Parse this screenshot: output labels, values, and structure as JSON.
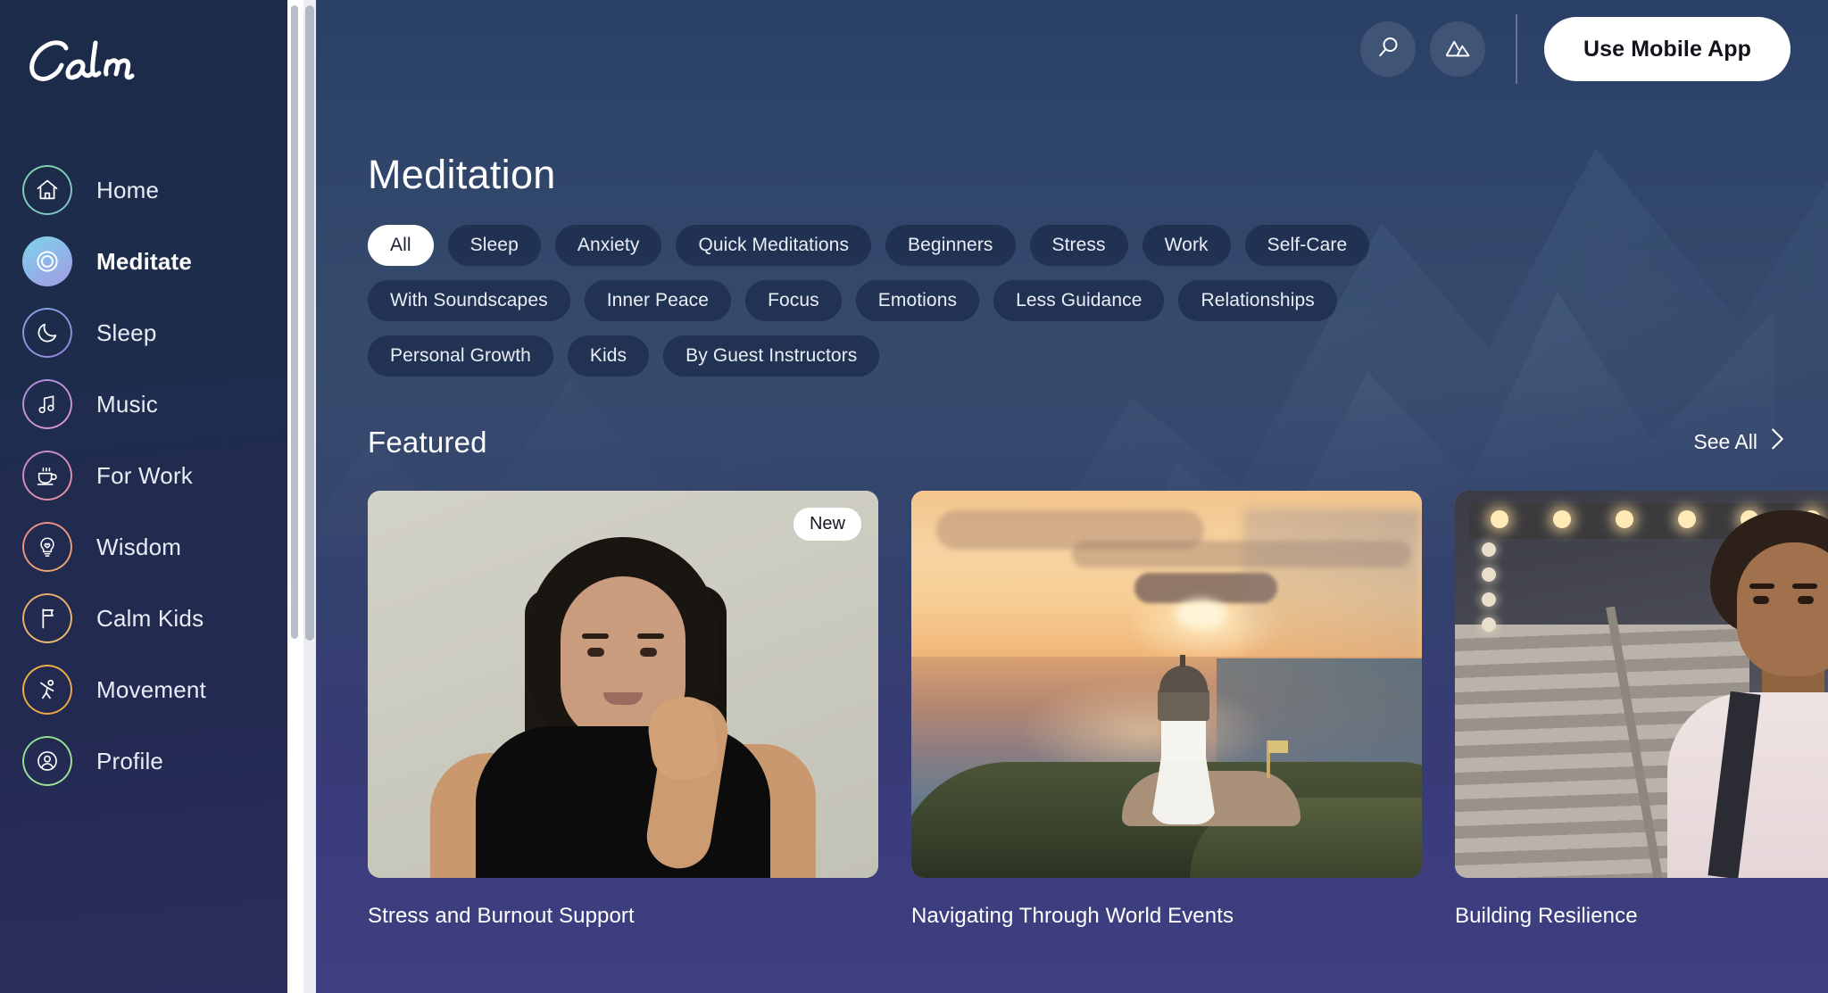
{
  "brand": {
    "name": "Calm"
  },
  "sidebar": {
    "items": [
      {
        "label": "Home",
        "icon": "home-icon",
        "active": false,
        "ring": [
          "#86d4b0",
          "#7fc6c9"
        ]
      },
      {
        "label": "Meditate",
        "icon": "meditate-icon",
        "active": true,
        "ring": [
          "#7fd4e8",
          "#a49be3"
        ]
      },
      {
        "label": "Sleep",
        "icon": "moon-icon",
        "active": false,
        "ring": [
          "#7fa8e0",
          "#9b86e0"
        ]
      },
      {
        "label": "Music",
        "icon": "music-note-icon",
        "active": false,
        "ring": [
          "#a88fe3",
          "#e09ad0"
        ]
      },
      {
        "label": "For Work",
        "icon": "coffee-cup-icon",
        "active": false,
        "ring": [
          "#c48be0",
          "#f0909f"
        ]
      },
      {
        "label": "Wisdom",
        "icon": "lightbulb-icon",
        "active": false,
        "ring": [
          "#f08a86",
          "#f0a86a"
        ]
      },
      {
        "label": "Calm Kids",
        "icon": "flag-icon",
        "active": false,
        "ring": [
          "#f0a86a",
          "#f0c06a"
        ]
      },
      {
        "label": "Movement",
        "icon": "stretch-icon",
        "active": false,
        "ring": [
          "#f5b14a",
          "#f0a63e"
        ]
      },
      {
        "label": "Profile",
        "icon": "person-icon",
        "active": false,
        "ring": [
          "#8fe08a",
          "#a6e89a"
        ]
      }
    ]
  },
  "header": {
    "search_icon": "search-icon",
    "scenes_icon": "mountain-scenes-icon",
    "mobile_app_label": "Use Mobile App"
  },
  "main": {
    "page_title": "Meditation",
    "filters": [
      [
        "All",
        "Sleep",
        "Anxiety",
        "Quick Meditations",
        "Beginners",
        "Stress",
        "Work",
        "Self-Care"
      ],
      [
        "With Soundscapes",
        "Inner Peace",
        "Focus",
        "Emotions",
        "Less Guidance",
        "Relationships"
      ],
      [
        "Personal Growth",
        "Kids",
        "By Guest Instructors"
      ]
    ],
    "active_filter": "All",
    "featured": {
      "title": "Featured",
      "see_all_label": "See All",
      "see_all_chevron": "chevron-right-icon",
      "cards": [
        {
          "title": "Stress and Burnout Support",
          "badge": "New",
          "image": "portrait-woman-beige"
        },
        {
          "title": "Navigating Through World Events",
          "badge": "",
          "image": "lighthouse-sunset-ocean"
        },
        {
          "title": "Building Resilience",
          "badge": "",
          "image": "young-man-on-stairs"
        }
      ]
    }
  }
}
